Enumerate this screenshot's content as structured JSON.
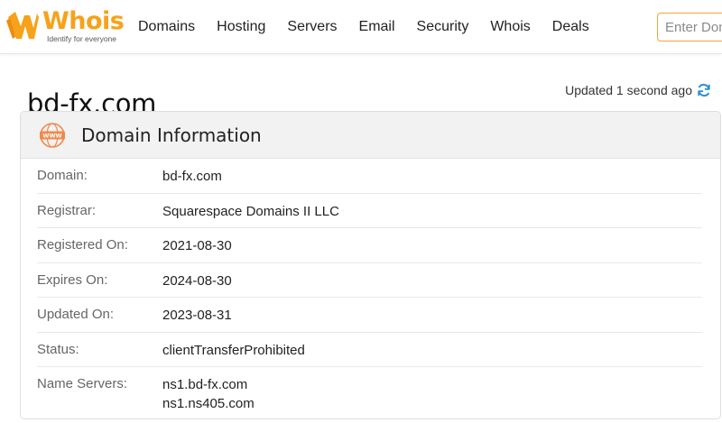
{
  "header": {
    "logo_text": "Whois",
    "logo_tagline": "Identify for everyone",
    "nav": [
      "Domains",
      "Hosting",
      "Servers",
      "Email",
      "Security",
      "Whois",
      "Deals"
    ],
    "search_placeholder": "Enter Domain",
    "accent_color": "#f6a21a"
  },
  "page": {
    "title": "bd-fx.com",
    "updated_text": "Updated 1 second ago"
  },
  "card": {
    "title": "Domain Information",
    "icon": "www-icon",
    "rows": [
      {
        "label": "Domain:",
        "values": [
          "bd-fx.com"
        ]
      },
      {
        "label": "Registrar:",
        "values": [
          "Squarespace Domains II LLC"
        ]
      },
      {
        "label": "Registered On:",
        "values": [
          "2021-08-30"
        ]
      },
      {
        "label": "Expires On:",
        "values": [
          "2024-08-30"
        ]
      },
      {
        "label": "Updated On:",
        "values": [
          "2023-08-31"
        ]
      },
      {
        "label": "Status:",
        "values": [
          "clientTransferProhibited"
        ]
      },
      {
        "label": "Name Servers:",
        "values": [
          "ns1.bd-fx.com",
          "ns1.ns405.com"
        ]
      }
    ]
  }
}
